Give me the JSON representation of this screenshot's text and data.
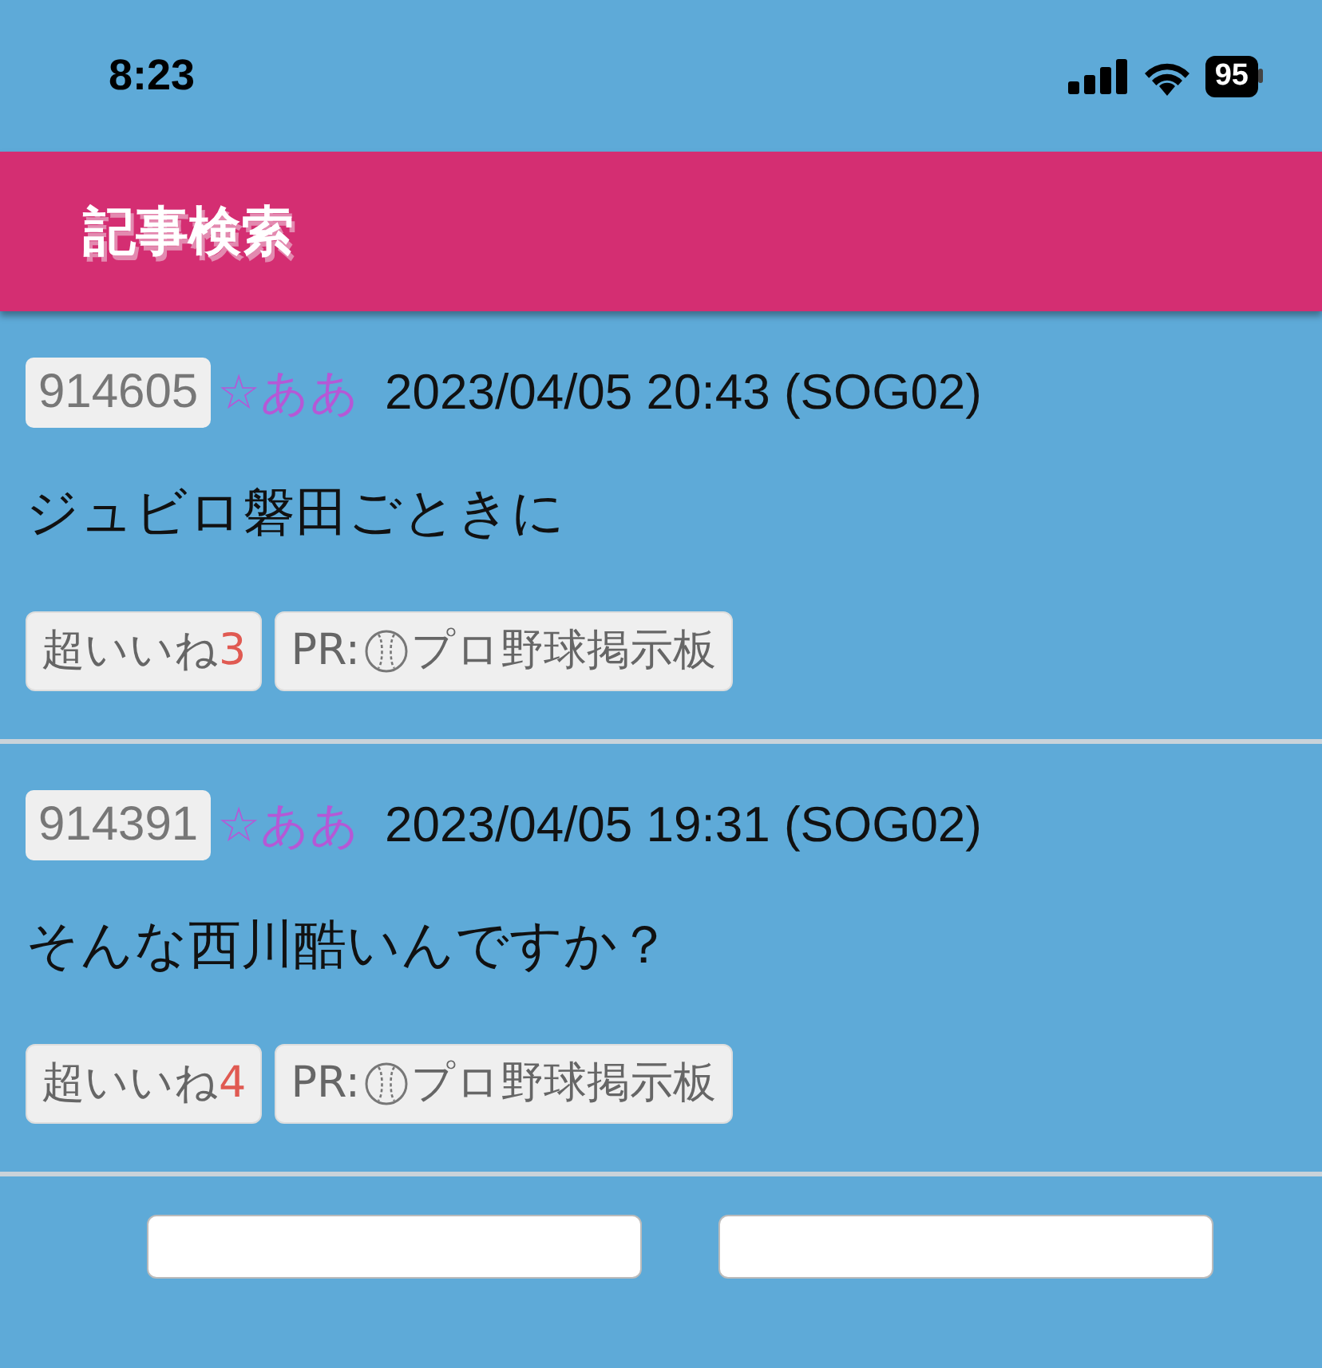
{
  "status_bar": {
    "time": "8:23",
    "battery": "95"
  },
  "header": {
    "title": "記事検索"
  },
  "posts": [
    {
      "number": "914605",
      "author": "☆ああ",
      "datetime": "2023/04/05 20:43 (SOG02)",
      "body": "ジュビロ磐田ごときに",
      "like_label": "超いいね",
      "like_count": "3",
      "pr_prefix": "PR:",
      "pr_label": "プロ野球掲示板"
    },
    {
      "number": "914391",
      "author": "☆ああ",
      "datetime": "2023/04/05 19:31 (SOG02)",
      "body": "そんな西川酷いんですか？",
      "like_label": "超いいね",
      "like_count": "4",
      "pr_prefix": "PR:",
      "pr_label": "プロ野球掲示板"
    }
  ]
}
